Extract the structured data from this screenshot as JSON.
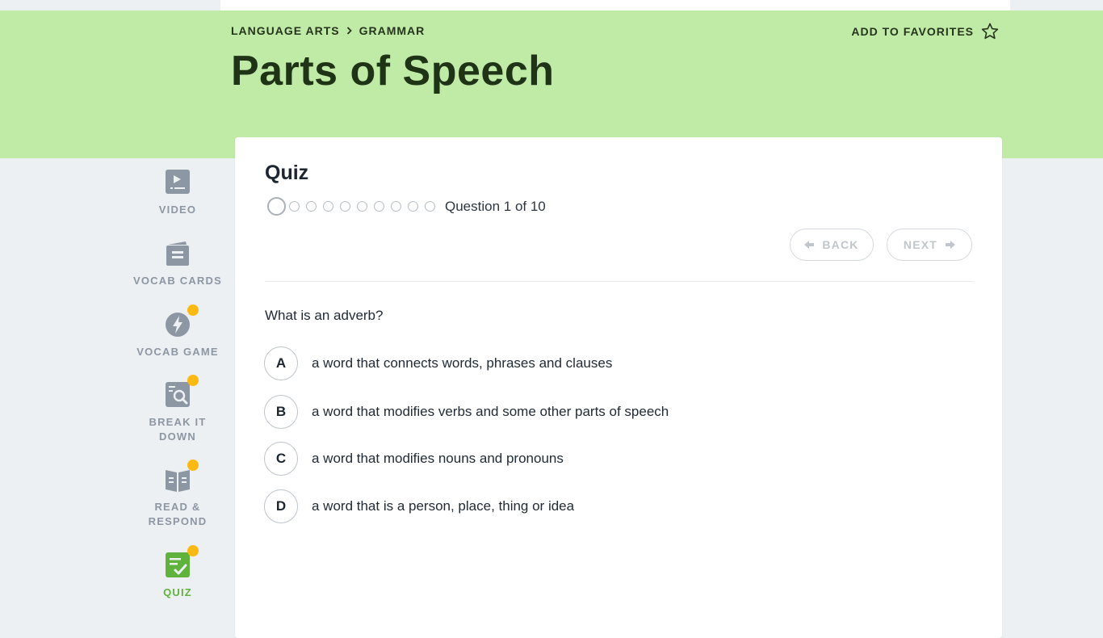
{
  "header": {
    "breadcrumbs": [
      "LANGUAGE ARTS",
      "GRAMMAR"
    ],
    "title": "Parts of Speech",
    "favorites_label": "ADD TO FAVORITES"
  },
  "sidebar": {
    "items": [
      {
        "label": "VIDEO",
        "icon": "video-icon",
        "badge": false,
        "active": false
      },
      {
        "label": "VOCAB CARDS",
        "icon": "vocab-cards-icon",
        "badge": false,
        "active": false
      },
      {
        "label": "VOCAB GAME",
        "icon": "lightning-icon",
        "badge": true,
        "active": false
      },
      {
        "label": "BREAK IT DOWN",
        "icon": "magnifier-icon",
        "badge": true,
        "active": false
      },
      {
        "label": "READ & RESPOND",
        "icon": "book-icon",
        "badge": true,
        "active": false
      },
      {
        "label": "QUIZ",
        "icon": "quiz-checklist-icon",
        "badge": true,
        "active": true
      }
    ]
  },
  "quiz": {
    "title": "Quiz",
    "progress_text": "Question 1 of 10",
    "current_question": 1,
    "total_questions": 10,
    "back_label": "BACK",
    "next_label": "NEXT",
    "question": "What is an adverb?",
    "options": [
      {
        "letter": "A",
        "text": "a word that connects words, phrases and clauses"
      },
      {
        "letter": "B",
        "text": "a word that modifies verbs and some other parts of speech"
      },
      {
        "letter": "C",
        "text": "a word that modifies nouns and pronouns"
      },
      {
        "letter": "D",
        "text": "a word that is a person, place, thing or idea"
      }
    ]
  },
  "colors": {
    "banner": "#c0eba6",
    "accent_green": "#5fb33c",
    "badge_orange": "#fdb913",
    "sidebar_gray": "#8d96a3"
  }
}
